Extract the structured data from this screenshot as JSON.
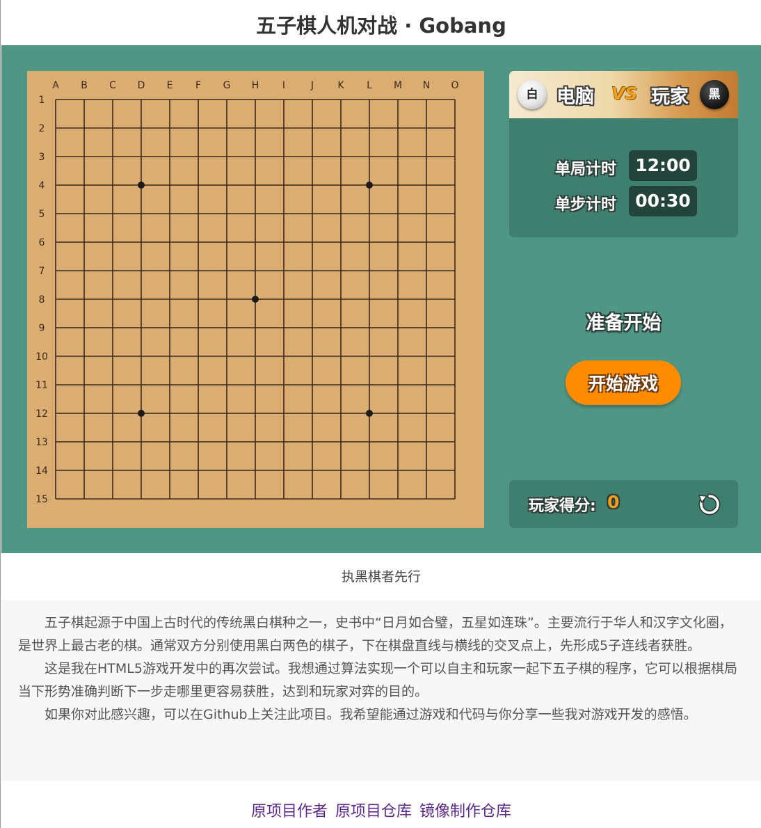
{
  "title": "五子棋人机对战 · Gobang",
  "board": {
    "columns": [
      "A",
      "B",
      "C",
      "D",
      "E",
      "F",
      "G",
      "H",
      "I",
      "J",
      "K",
      "L",
      "M",
      "N",
      "O"
    ],
    "rows": [
      "1",
      "2",
      "3",
      "4",
      "5",
      "6",
      "7",
      "8",
      "9",
      "10",
      "11",
      "12",
      "13",
      "14",
      "15"
    ],
    "star_points": [
      "D4",
      "L4",
      "H8",
      "D12",
      "L12"
    ],
    "colors": {
      "board": "#dbad72",
      "line": "#3a2a1a",
      "frame": "#509684"
    }
  },
  "panel": {
    "cpu_stone": "白",
    "cpu_name": "电脑",
    "vs": "VS",
    "player_name": "玩家",
    "player_stone": "黑",
    "game_timer_label": "单局计时",
    "game_timer_value": "12:00",
    "step_timer_label": "单步计时",
    "step_timer_value": "00:30",
    "status": "准备开始",
    "start_button": "开始游戏",
    "score_label": "玩家得分:",
    "score_value": "0",
    "reset_icon": "refresh-icon",
    "accent": "#ff8c00"
  },
  "caption": "执黑棋者先行",
  "intro": [
    "五子棋起源于中国上古时代的传统黑白棋种之一，史书中“日月如合璧，五星如连珠”。主要流行于华人和汉字文化圈，是世界上最古老的棋。通常双方分别使用黑白两色的棋子，下在棋盘直线与横线的交叉点上，先形成5子连线者获胜。",
    "这是我在HTML5游戏开发中的再次尝试。我想通过算法实现一个可以自主和玩家一起下五子棋的程序，它可以根据棋局当下形势准确判断下一步走哪里更容易获胜，达到和玩家对弈的目的。",
    "如果你对此感兴趣，可以在Github上关注此项目。我希望能通过游戏和代码与你分享一些我对游戏开发的感悟。"
  ],
  "links": [
    "原项目作者",
    "原项目仓库",
    "镜像制作仓库"
  ]
}
